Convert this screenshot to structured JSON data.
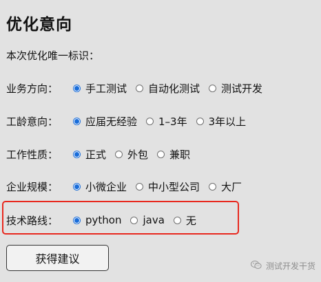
{
  "page_title": "优化意向",
  "id_label": "本次优化唯一标识：",
  "groups": [
    {
      "label": "业务方向：",
      "options": [
        "手工测试",
        "自动化测试",
        "测试开发"
      ],
      "selected": 0
    },
    {
      "label": "工龄意向：",
      "options": [
        "应届无经验",
        "1–3年",
        "3年以上"
      ],
      "selected": 0
    },
    {
      "label": "工作性质：",
      "options": [
        "正式",
        "外包",
        "兼职"
      ],
      "selected": 0
    },
    {
      "label": "企业规模：",
      "options": [
        "小微企业",
        "中小型公司",
        "大厂"
      ],
      "selected": 0
    },
    {
      "label": "技术路线：",
      "options": [
        "python",
        "java",
        "无"
      ],
      "selected": 0
    }
  ],
  "submit_label": "获得建议",
  "watermark": {
    "text": "测试开发干货",
    "icon": "wechat-icon"
  },
  "colors": {
    "background": "#e2e2e2",
    "radio_checked": "#1a6dd9",
    "highlight_border": "#e8281e"
  }
}
